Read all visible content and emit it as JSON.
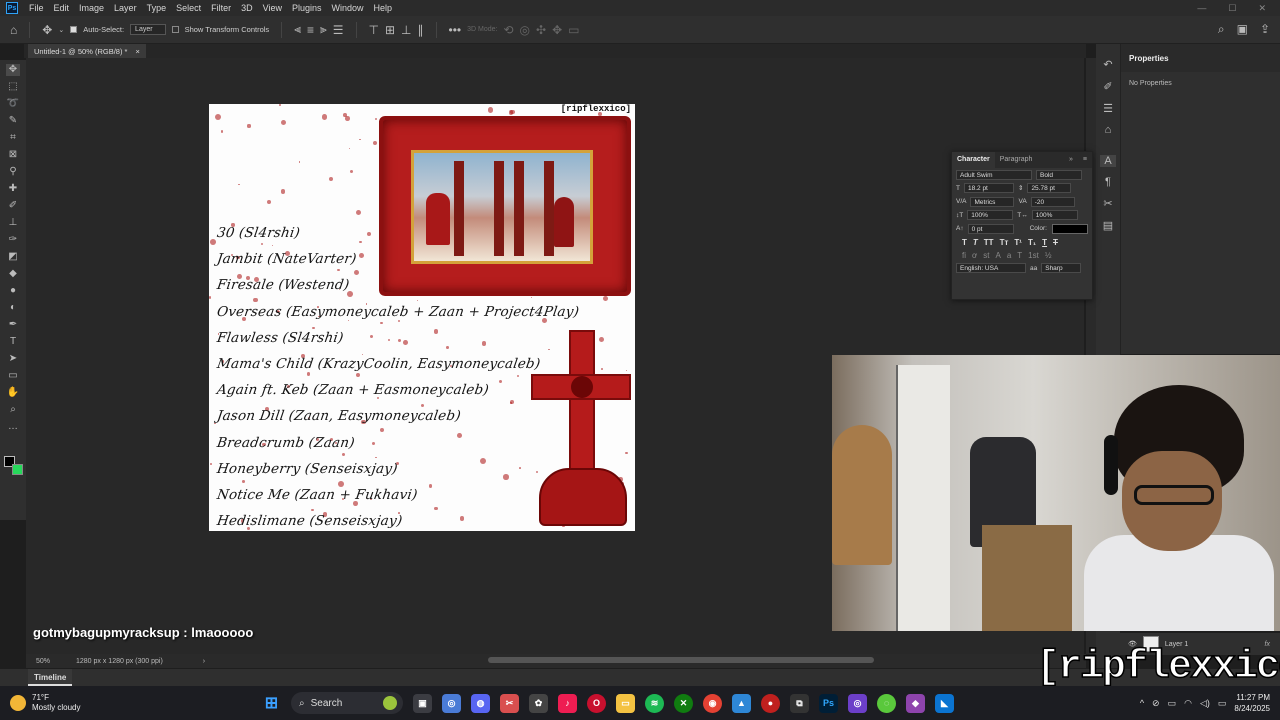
{
  "menubar": {
    "app_icon": "Ps",
    "items": [
      "File",
      "Edit",
      "Image",
      "Layer",
      "Type",
      "Select",
      "Filter",
      "3D",
      "View",
      "Plugins",
      "Window",
      "Help"
    ]
  },
  "options": {
    "auto_select_label": "Auto-Select:",
    "auto_select_target": "Layer",
    "transform_controls_label": "Show Transform Controls",
    "mode_3d_label": "3D Mode:"
  },
  "document": {
    "tab_title": "Untitled-1 @ 50% (RGB/8) *",
    "zoom": "50%",
    "dimensions": "1280 px x 1280 px (300 ppi)"
  },
  "artwork": {
    "corner_tag": "[ripflexxico]",
    "tracks": [
      "30 (Sl4rshi)",
      "Jambit (NateVarter)",
      "Firesale (Westend)",
      "Overseas (Easymoneycaleb + Zaan + Project4Play)",
      "Flawless (Sl4rshi)",
      "Mama's Child (KrazyCoolin, Easymoneycaleb)",
      "Again ft. Keb (Zaan + Easmoneycaleb)",
      "Jason Dill (Zaan, Easymoneycaleb)",
      "Breadcrumb (Zaan)",
      "Honeyberry (Senseisxjay)",
      "Notice Me (Zaan + Fukhavi)",
      "Hedislimane (Senseisxjay)"
    ]
  },
  "properties": {
    "title": "Properties",
    "body": "No Properties"
  },
  "character": {
    "tab_character": "Character",
    "tab_paragraph": "Paragraph",
    "font_family": "Adult Swim",
    "font_style": "Bold",
    "font_size": "18.2 pt",
    "leading": "25.78 pt",
    "kerning": "Metrics",
    "tracking": "-20",
    "vscale": "100%",
    "hscale": "100%",
    "baseline": "0 pt",
    "color_label": "Color:",
    "language": "English: USA",
    "antialias": "Sharp",
    "glyphs": [
      "T",
      "T",
      "TT",
      "Tт",
      "T¹",
      "T₁",
      "T",
      "T"
    ]
  },
  "layers": {
    "layer_name": "Layer 1",
    "fx_label": "fx"
  },
  "timeline": {
    "tab": "Timeline"
  },
  "stream": {
    "brand": "[ripflexxico]",
    "chat_user": "gotmybagupmyracksup",
    "chat_message": " : lmaooooo"
  },
  "taskbar": {
    "weather_temp": "71°F",
    "weather_desc": "Mostly cloudy",
    "search_placeholder": "Search",
    "time": "11:27 PM",
    "date": "8/24/2025"
  },
  "colors": {
    "ps_blue": "#2fa3f7",
    "background_swatch": "#27d85b",
    "artwork_red": "#b51d1d"
  }
}
